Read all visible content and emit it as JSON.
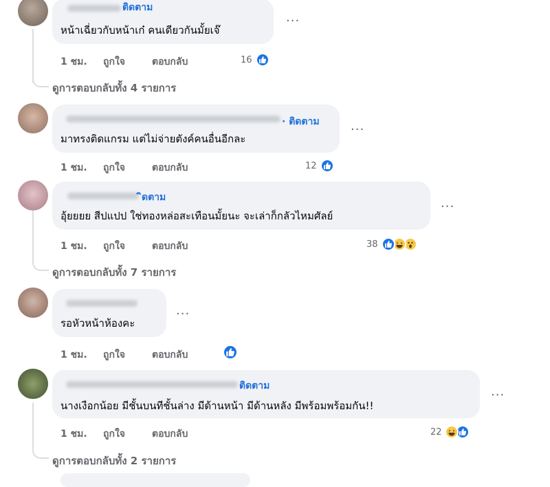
{
  "comments": [
    {
      "follow": "ติดตาม",
      "text": "หน้าเฉี่ยวกับหน้าเก๋ คนเดียวกันมั้ยเจ๊",
      "time": "1 ชม.",
      "like": "ถูกใจ",
      "reply": "ตอบกลับ",
      "reaction_count": "16",
      "reactions": [
        "like-icon"
      ],
      "view_replies": "ดูการตอบกลับทั้ง 4 รายการ"
    },
    {
      "follow": "· ติดตาม",
      "text": "มาทรงติดแกรม แต่ไม่จ่ายตังค์คนอื่นอีกละ",
      "time": "1 ชม.",
      "like": "ถูกใจ",
      "reply": "ตอบกลับ",
      "reaction_count": "12",
      "reactions": [
        "like-icon"
      ]
    },
    {
      "follow": "ิดตาม",
      "text": "อุ้ยยยย สีปแปป ใช่ทองหล่อสะเทือนมั้ยนะ จะเล่าก็กลัวไหมศัลย์",
      "time": "1 ชม.",
      "like": "ถูกใจ",
      "reply": "ตอบกลับ",
      "reaction_count": "38",
      "reactions": [
        "like-icon",
        "haha-icon",
        "wow-icon"
      ],
      "view_replies": "ดูการตอบกลับทั้ง 7 รายการ"
    },
    {
      "text": "รอหัวหน้าห้องคะ",
      "time": "1 ชม.",
      "like": "ถูกใจ",
      "reply": "ตอบกลับ",
      "reactions": [
        "like-icon"
      ]
    },
    {
      "follow": "ติดตาม",
      "text": "นางเงือกน้อย มีชั้นบนทีชั้นล่าง มีด้านหน้า มีด้านหลัง มีพร้อมพร้อมกัน!!",
      "time": "1 ชม.",
      "like": "ถูกใจ",
      "reply": "ตอบกลับ",
      "reaction_count": "22",
      "reactions": [
        "haha-icon",
        "like-icon"
      ],
      "view_replies": "ดูการตอบกลับทั้ง 2 รายการ"
    }
  ],
  "more_label": "···",
  "colors": {
    "bubble": "#f0f2f5",
    "follow_link": "#216fdb",
    "muted_text": "#65676b",
    "like_blue": "#1b74e4",
    "haha_yellow": "#f7c84b"
  }
}
